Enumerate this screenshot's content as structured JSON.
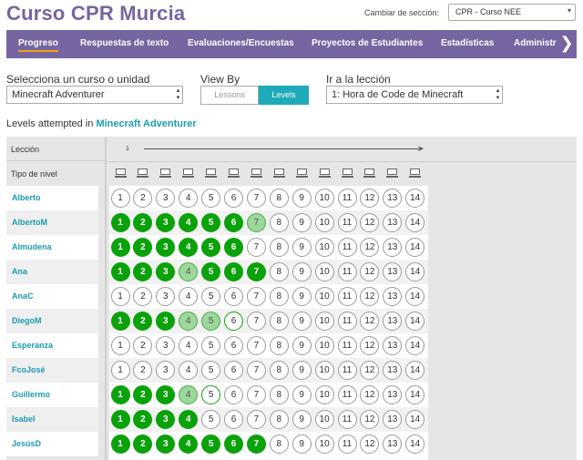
{
  "header": {
    "title": "Curso CPR Murcia",
    "section_label": "Cambiar de sección:",
    "section_value": "CPR - Curso NEE"
  },
  "nav": {
    "items": [
      "Progreso",
      "Respuestas de texto",
      "Evaluaciones/Encuestas",
      "Proyectos de Estudiantes",
      "Estadísticas",
      "Administra"
    ],
    "active": "Progreso",
    "next_icon": "chevron-right-icon"
  },
  "controls": {
    "course_label": "Selecciona un curso o unidad",
    "course_value": "Minecraft Adventurer",
    "viewby_label": "View By",
    "viewby_options": [
      "Lessons",
      "Levels"
    ],
    "viewby_selected": "Levels",
    "goto_label": "Ir a la lección",
    "goto_value": "1: Hora de Code de Minecraft"
  },
  "summary": {
    "prefix": "Levels attempted in",
    "course": "Minecraft Adventurer"
  },
  "grid": {
    "lesson_header": "Lección",
    "level_type_header": "Tipo de nivel",
    "lesson_number": "1",
    "level_icon": "computer-icon",
    "levels": [
      "1",
      "2",
      "3",
      "4",
      "5",
      "6",
      "7",
      "8",
      "9",
      "10",
      "11",
      "12",
      "13",
      "14"
    ],
    "status_legend": {
      "p": "perfect",
      "s": "passed",
      "a": "attempted",
      "n": "not-started"
    },
    "students": [
      {
        "name": "Alberto",
        "status": "nnnnnnnnnnnnnn"
      },
      {
        "name": "AlbertoM",
        "status": "ppppppsnnnnnnn"
      },
      {
        "name": "Almudena",
        "status": "ppppppnnnnnnnn"
      },
      {
        "name": "Ana",
        "status": "pppspppnnnnnnn"
      },
      {
        "name": "AnaC",
        "status": "nnnnnnnnnnnnnn"
      },
      {
        "name": "DiegoM",
        "status": "pppssannnnnnnn"
      },
      {
        "name": "Esperanza",
        "status": "nnnnnnnnnnnnnn"
      },
      {
        "name": "FcoJosé",
        "status": "nnnnnnnnnnnnnn"
      },
      {
        "name": "Guillermo",
        "status": "pppsannnnnnnnn"
      },
      {
        "name": "Isabel",
        "status": "ppppnnnnnnnnnn"
      },
      {
        "name": "JesúsD",
        "status": "pppppppnnnnnnn"
      }
    ]
  },
  "colors": {
    "brand": "#7665a0",
    "accent_tab": "#f0a30a",
    "link": "#1a9cb0",
    "toggle_on": "#1eaab8",
    "perfect": "#0aa20a",
    "passed": "#9cd79c"
  }
}
